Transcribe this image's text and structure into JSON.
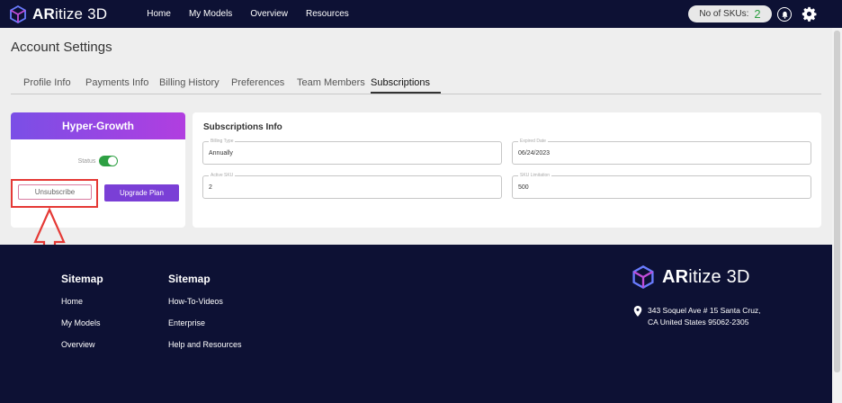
{
  "header": {
    "brand_bold": "AR",
    "brand_rest": "itize 3D",
    "nav": [
      "Home",
      "My Models",
      "Overview",
      "Resources"
    ],
    "sku_label": "No of SKUs:",
    "sku_count": "2"
  },
  "page": {
    "title": "Account Settings",
    "tabs": [
      "Profile Info",
      "Payments Info",
      "Billing History",
      "Preferences",
      "Team Members",
      "Subscriptions"
    ]
  },
  "plan": {
    "name": "Hyper-Growth",
    "status_label": "Status",
    "unsubscribe_label": "Unsubscribe",
    "upgrade_label": "Upgrade Plan"
  },
  "subscriptions_info": {
    "title": "Subscriptions Info",
    "fields": [
      {
        "label": "Billing Type",
        "value": "Annually"
      },
      {
        "label": "Expired Date",
        "value": "06/24/2023"
      },
      {
        "label": "Active SKU",
        "value": "2"
      },
      {
        "label": "SKU Limitation",
        "value": "500"
      }
    ]
  },
  "footer": {
    "col1_title": "Sitemap",
    "col1_links": [
      "Home",
      "My Models",
      "Overview"
    ],
    "col2_title": "Sitemap",
    "col2_links": [
      "How-To-Videos",
      "Enterprise",
      "Help and Resources"
    ],
    "brand_bold": "AR",
    "brand_rest": "itize 3D",
    "address_line1": "343 Soquel Ave # 15 Santa Cruz,",
    "address_line2": "CA United States 95062-2305"
  },
  "colors": {
    "nav_bg": "#0d1134",
    "accent": "#7a3fd6",
    "toggle_on": "#2ea043",
    "highlight": "#e53935"
  }
}
